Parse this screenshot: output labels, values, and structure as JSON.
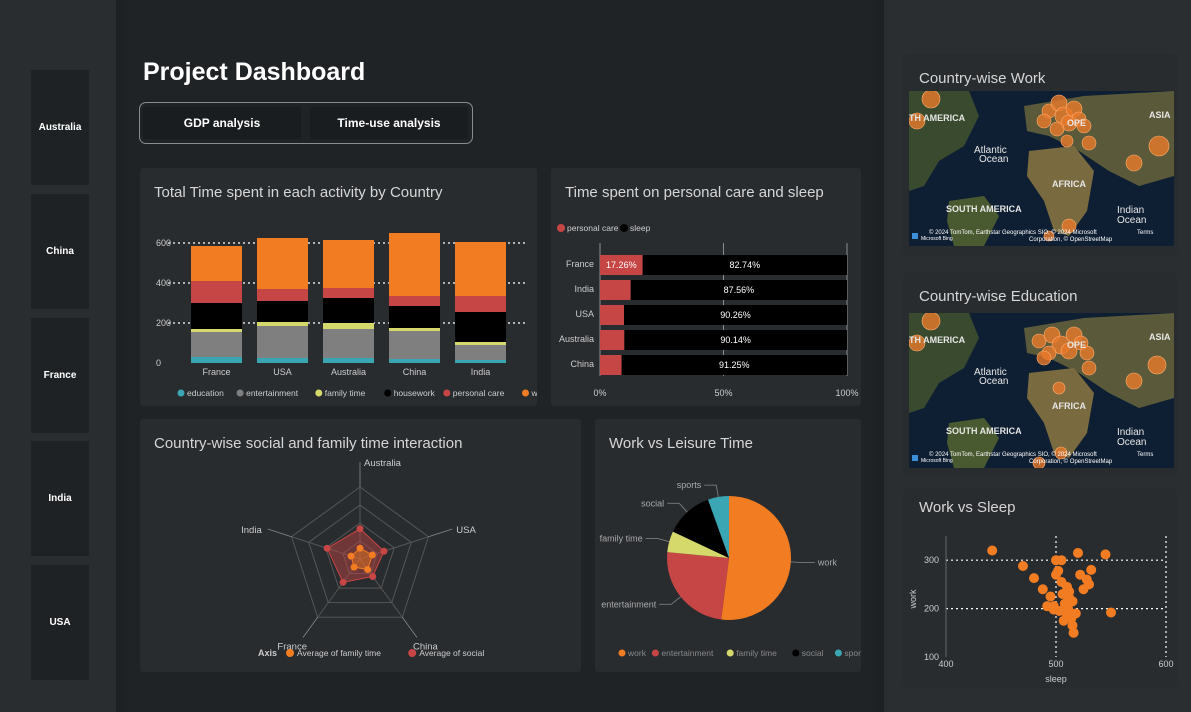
{
  "slicer": {
    "items": [
      "Australia",
      "China",
      "France",
      "India",
      "USA"
    ]
  },
  "header": {
    "title": "Project Dashboard"
  },
  "tabs": [
    "GDP analysis",
    "Time-use analysis"
  ],
  "colors": {
    "education": "#3aa6b4",
    "entertainment": "#7f7f7f",
    "family time": "#d5d86a",
    "housework": "#000000",
    "personal care": "#c64545",
    "work": "#f27c22",
    "social": "#000000",
    "sports": "#3aa6b4",
    "sleep": "#000000"
  },
  "stacked": {
    "title": "Total Time spent in each activity by Country",
    "chart_data": {
      "type": "bar",
      "stacked": true,
      "categories": [
        "France",
        "USA",
        "Australia",
        "China",
        "India"
      ],
      "series": [
        {
          "name": "education",
          "values": [
            30,
            25,
            25,
            20,
            15
          ]
        },
        {
          "name": "entertainment",
          "values": [
            125,
            160,
            145,
            140,
            75
          ]
        },
        {
          "name": "family time",
          "values": [
            15,
            20,
            30,
            15,
            15
          ]
        },
        {
          "name": "housework",
          "values": [
            130,
            105,
            125,
            110,
            150
          ]
        },
        {
          "name": "personal care",
          "values": [
            110,
            60,
            50,
            50,
            80
          ]
        },
        {
          "name": "work",
          "values": [
            175,
            255,
            240,
            315,
            270
          ]
        }
      ],
      "yticks": [
        "0",
        "200",
        "400",
        "600"
      ],
      "ylim": [
        0,
        660
      ],
      "grid": true,
      "legend": "bottom"
    }
  },
  "care": {
    "title": "Time spent on personal care and sleep",
    "chart_data": {
      "type": "bar",
      "orientation": "horizontal",
      "stacked_percent": true,
      "categories": [
        "France",
        "India",
        "USA",
        "Australia",
        "China"
      ],
      "series": [
        {
          "name": "personal care",
          "values": [
            17.26,
            12.44,
            9.74,
            9.86,
            8.75
          ],
          "labels": [
            "17.26%",
            "",
            "",
            "",
            ""
          ]
        },
        {
          "name": "sleep",
          "values": [
            82.74,
            87.56,
            90.26,
            90.14,
            91.25
          ],
          "labels": [
            "82.74%",
            "87.56%",
            "90.26%",
            "90.14%",
            "91.25%"
          ]
        }
      ],
      "xticks": [
        "0%",
        "50%",
        "100%"
      ],
      "legend": "top-left"
    }
  },
  "radar": {
    "title": "Country-wise social and family time interaction",
    "chart_data": {
      "type": "radar",
      "axes": [
        "Australia",
        "USA",
        "China",
        "France",
        "India"
      ],
      "series": [
        {
          "name": "Average of family time",
          "values": [
            15,
            18,
            18,
            14,
            13
          ]
        },
        {
          "name": "Average of social",
          "values": [
            42,
            35,
            30,
            40,
            48
          ]
        }
      ],
      "max": 100
    },
    "legend_title": "Axis"
  },
  "pie": {
    "title": "Work vs Leisure Time",
    "chart_data": {
      "type": "pie",
      "labels": [
        "work",
        "entertainment",
        "family time",
        "social",
        "sports"
      ],
      "values": [
        52,
        24.5,
        5.5,
        12.5,
        5.5
      ]
    }
  },
  "mapWork": {
    "title": "Country-wise Work"
  },
  "mapEdu": {
    "title": "Country-wise Education"
  },
  "map": {
    "labels": [
      "TH AMERICA",
      "OPE",
      "ASIA",
      "Atlantic",
      "Ocean",
      "AFRICA",
      "SOUTH AMERICA",
      "Indian",
      "Ocean"
    ],
    "attribution1": "© 2024 TomTom, Earthstar Geographics SIO, © 2024 Microsoft",
    "terms": "Terms",
    "attribution2": "Corporation, © OpenStreetMap",
    "bing": "Microsoft Bing"
  },
  "scatter": {
    "title": "Work vs Sleep",
    "chart_data": {
      "type": "scatter",
      "xlabel": "sleep",
      "ylabel": "work",
      "xlim": [
        400,
        600
      ],
      "ylim": [
        100,
        350
      ],
      "xticks": [
        "400",
        "500",
        "600"
      ],
      "yticks": [
        "100",
        "200",
        "300"
      ],
      "x": [
        442,
        470,
        480,
        488,
        492,
        495,
        498,
        500,
        502,
        505,
        506,
        508,
        510,
        511,
        512,
        514,
        515,
        516,
        518,
        520,
        522,
        525,
        528,
        530,
        532,
        545,
        550,
        505,
        500,
        498,
        510,
        515,
        512,
        503,
        507
      ],
      "y": [
        320,
        288,
        263,
        240,
        205,
        225,
        198,
        300,
        278,
        255,
        230,
        210,
        245,
        200,
        222,
        180,
        165,
        150,
        190,
        315,
        270,
        240,
        260,
        250,
        280,
        312,
        192,
        300,
        270,
        205,
        185,
        215,
        235,
        195,
        175
      ]
    }
  }
}
